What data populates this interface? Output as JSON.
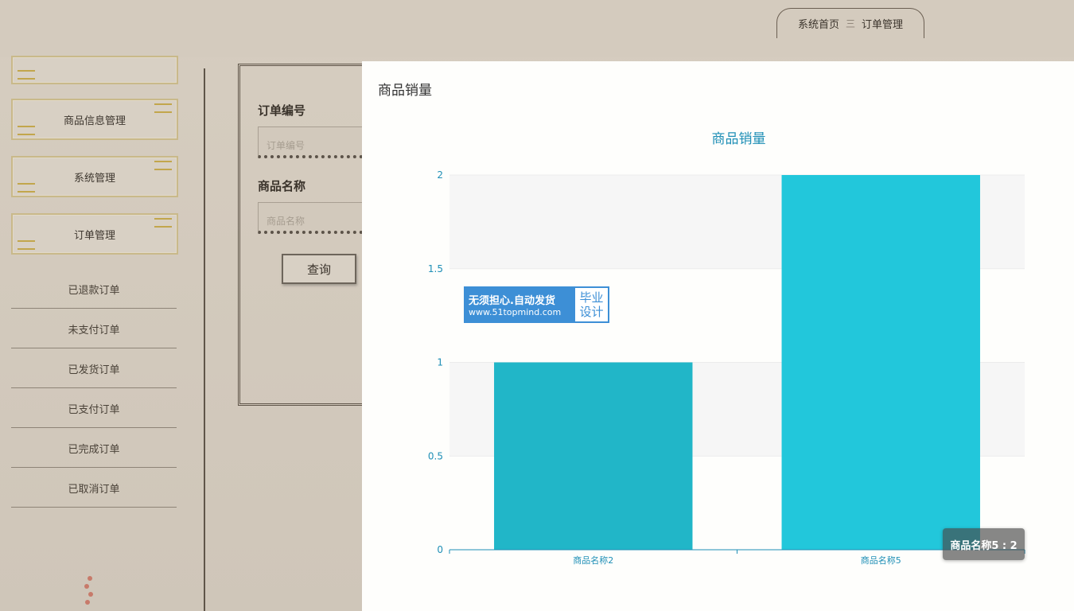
{
  "breadcrumb": {
    "home": "系统首页",
    "separator": "三",
    "current": "订单管理"
  },
  "sidebar": {
    "cards": [
      "商品信息管理",
      "系统管理",
      "订单管理"
    ],
    "sub_items": [
      "已退款订单",
      "未支付订单",
      "已发货订单",
      "已支付订单",
      "已完成订单",
      "已取消订单"
    ]
  },
  "search": {
    "order_no_label": "订单编号",
    "order_no_placeholder": "订单编号",
    "product_name_label": "商品名称",
    "product_name_placeholder": "商品名称",
    "query_label": "查询"
  },
  "modal": {
    "title": "商品销量"
  },
  "watermark": {
    "line1": "无须担心.自动发货",
    "line2": "www.51topmind.com",
    "right_top": "毕业",
    "right_bottom": "设计"
  },
  "tooltip": {
    "text": "商品名称5 : 2"
  },
  "colors": {
    "bar1": "#21b6c8",
    "bar2": "#22c7db",
    "title": "#1f8fb6",
    "axis": "#1f8fb6"
  },
  "chart_data": {
    "type": "bar",
    "title": "商品销量",
    "categories": [
      "商品名称2",
      "商品名称5"
    ],
    "values": [
      1,
      2
    ],
    "ylim": [
      0,
      2
    ],
    "yticks": [
      "0",
      "0.5",
      "1",
      "1.5",
      "2"
    ],
    "grid": true,
    "xlabel": "",
    "ylabel": ""
  }
}
